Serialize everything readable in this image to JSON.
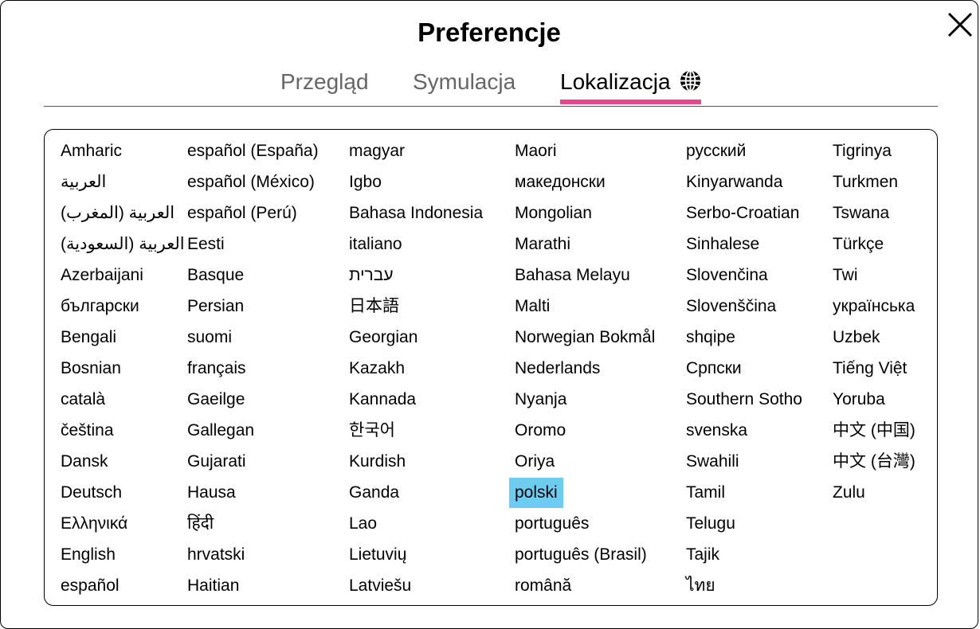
{
  "dialog": {
    "title": "Preferencje",
    "close_icon": "close-icon"
  },
  "tabs": [
    {
      "label": "Przegląd",
      "active": false
    },
    {
      "label": "Symulacja",
      "active": false
    },
    {
      "label": "Lokalizacja",
      "active": true,
      "icon": "globe-icon"
    }
  ],
  "colors": {
    "active_tab_underline": "#e8478b",
    "selected_language_bg": "#6ccdf0",
    "inactive_tab_text": "#666666"
  },
  "selected_language": "polski",
  "languages": [
    [
      "Amharic",
      "العربية",
      "العربية (المغرب)",
      "العربية (السعودية)",
      "Azerbaijani",
      "български",
      "Bengali",
      "Bosnian",
      "català",
      "čeština",
      "Dansk",
      "Deutsch",
      "Ελληνικά",
      "English",
      "español"
    ],
    [
      "español (España)",
      "español (México)",
      "español (Perú)",
      "Eesti",
      "Basque",
      "Persian",
      "suomi",
      "français",
      "Gaeilge",
      "Gallegan",
      "Gujarati",
      "Hausa",
      "हिंदी",
      "hrvatski",
      "Haitian"
    ],
    [
      "magyar",
      "Igbo",
      "Bahasa Indonesia",
      "italiano",
      "עברית",
      "日本語",
      "Georgian",
      "Kazakh",
      "Kannada",
      "한국어",
      "Kurdish",
      "Ganda",
      "Lao",
      "Lietuvių",
      "Latviešu"
    ],
    [
      "Maori",
      "македонски",
      "Mongolian",
      "Marathi",
      "Bahasa Melayu",
      "Malti",
      "Norwegian Bokmål",
      "Nederlands",
      "Nyanja",
      "Oromo",
      "Oriya",
      "polski",
      "português",
      "português (Brasil)",
      "română"
    ],
    [
      "русский",
      "Kinyarwanda",
      "Serbo-Croatian",
      "Sinhalese",
      "Slovenčina",
      "Slovenščina",
      "shqipe",
      "Српски",
      "Southern Sotho",
      "svenska",
      "Swahili",
      "Tamil",
      "Telugu",
      "Tajik",
      "ไทย"
    ],
    [
      "Tigrinya",
      "Turkmen",
      "Tswana",
      "Türkçe",
      "Twi",
      "українська",
      "Uzbek",
      "Tiếng Việt",
      "Yoruba",
      "中文 (中国)",
      "中文 (台灣)",
      "Zulu"
    ]
  ]
}
